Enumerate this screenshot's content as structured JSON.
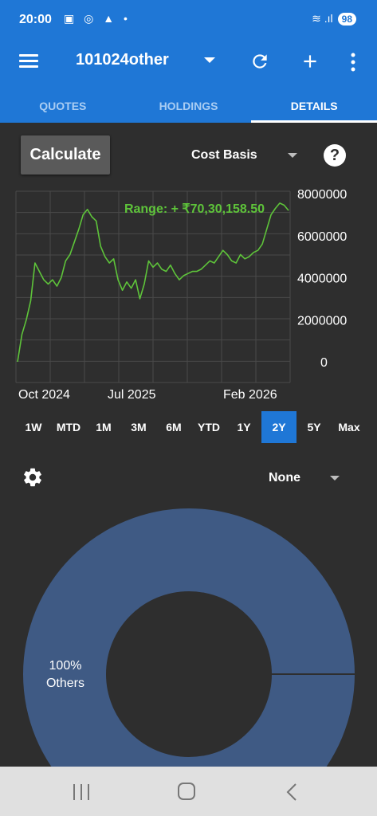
{
  "status": {
    "time": "20:00",
    "left_icons": "▣ ◎ ▲ •",
    "signal": "≋ .ıl",
    "battery": "98"
  },
  "appbar": {
    "title": "101024other",
    "icons": [
      "menu-icon",
      "caret-down-icon",
      "refresh-icon",
      "add-icon",
      "more-vert-icon"
    ]
  },
  "tabs": [
    {
      "label": "QUOTES",
      "active": false
    },
    {
      "label": "HOLDINGS",
      "active": false
    },
    {
      "label": "DETAILS",
      "active": true
    }
  ],
  "controls": {
    "calculate_label": "Calculate",
    "basis_value": "Cost Basis",
    "help_label": "?"
  },
  "chart_data": {
    "type": "line",
    "annotation": "Range: + ₹70,30,158.50",
    "line_color": "#5ec43a",
    "x_ticks": [
      "Oct 2024",
      "Jul 2025",
      "Feb 2026"
    ],
    "y_ticks": [
      "8000000",
      "6000000",
      "4000000",
      "2000000",
      "0"
    ],
    "ylim": [
      0,
      8000000
    ],
    "grid": true,
    "series": [
      {
        "values": [
          0,
          1300000,
          2000000,
          2900000,
          4700000,
          4300000,
          3900000,
          3700000,
          3900000,
          3600000,
          4000000,
          4800000,
          5100000,
          5700000,
          6300000,
          7000000,
          7250000,
          6900000,
          6700000,
          5500000,
          5000000,
          4700000,
          4900000,
          3900000,
          3400000,
          3800000,
          3500000,
          3900000,
          3000000,
          3700000,
          4800000,
          4500000,
          4700000,
          4400000,
          4300000,
          4600000,
          4200000,
          3900000,
          4100000,
          4200000,
          4300000,
          4300000,
          4400000,
          4600000,
          4800000,
          4700000,
          5000000,
          5300000,
          5100000,
          4800000,
          4700000,
          5100000,
          4900000,
          5000000,
          5200000,
          5300000,
          5600000,
          6300000,
          7000000,
          7300000,
          7550000,
          7450000,
          7200000
        ]
      }
    ]
  },
  "range_buttons": [
    {
      "label": "1W",
      "active": false
    },
    {
      "label": "MTD",
      "active": false
    },
    {
      "label": "1M",
      "active": false
    },
    {
      "label": "3M",
      "active": false
    },
    {
      "label": "6M",
      "active": false
    },
    {
      "label": "YTD",
      "active": false
    },
    {
      "label": "1Y",
      "active": false
    },
    {
      "label": "2Y",
      "active": true
    },
    {
      "label": "5Y",
      "active": false
    },
    {
      "label": "Max",
      "active": false
    }
  ],
  "breakdown": {
    "group_value": "None",
    "slice_percent": "100%",
    "slice_label": "Others",
    "slice_color": "#3f5a84"
  }
}
